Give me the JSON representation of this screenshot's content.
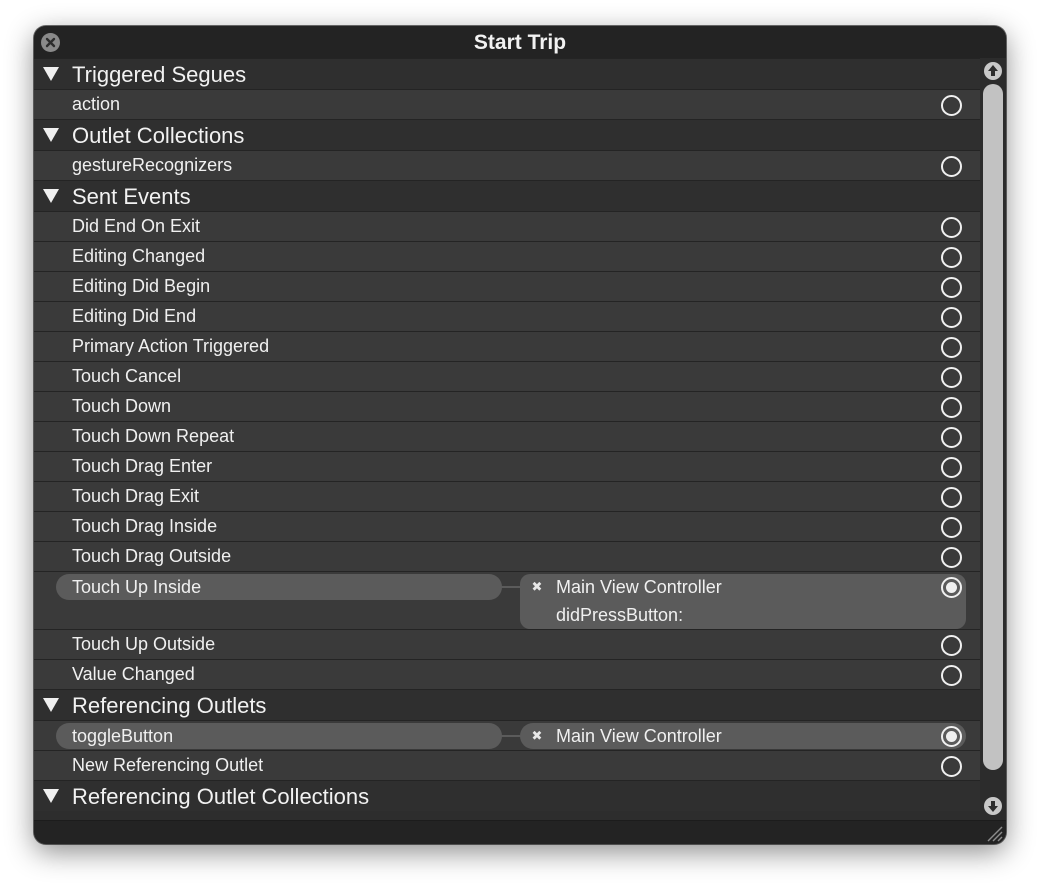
{
  "window": {
    "title": "Start Trip"
  },
  "sections": {
    "triggered_segues": "Triggered Segues",
    "outlet_collections": "Outlet Collections",
    "sent_events": "Sent Events",
    "referencing_outlets": "Referencing Outlets",
    "referencing_outlet_collections": "Referencing Outlet Collections"
  },
  "triggered_segues": {
    "items": [
      "action"
    ]
  },
  "outlet_collections": {
    "items": [
      "gestureRecognizers"
    ]
  },
  "sent_events": {
    "items": [
      "Did End On Exit",
      "Editing Changed",
      "Editing Did Begin",
      "Editing Did End",
      "Primary Action Triggered",
      "Touch Cancel",
      "Touch Down",
      "Touch Down Repeat",
      "Touch Drag Enter",
      "Touch Drag Exit",
      "Touch Drag Inside",
      "Touch Drag Outside",
      "Touch Up Inside",
      "Touch Up Outside",
      "Value Changed"
    ],
    "touch_up_inside_connection": {
      "target": "Main View Controller",
      "method": "didPressButton:",
      "remove_glyph": "✖"
    }
  },
  "referencing_outlets": {
    "items": [
      "toggleButton",
      "New Referencing Outlet"
    ],
    "toggle_button_connection": {
      "target": "Main View Controller",
      "remove_glyph": "✖"
    }
  },
  "icons": {
    "close": "close-icon",
    "disclosure": "disclosure-triangle-icon",
    "scroll_up": "arrow-up-icon",
    "scroll_down": "arrow-down-icon",
    "resize": "resize-grip-icon"
  },
  "colors": {
    "window_bg": "#2d2d2d",
    "titlebar_bg": "#232323",
    "row_bg": "#3a3a3a",
    "section_bg": "#2f2f2f",
    "connection_pill": "#5b5b5b",
    "text": "#f0f0f0"
  }
}
